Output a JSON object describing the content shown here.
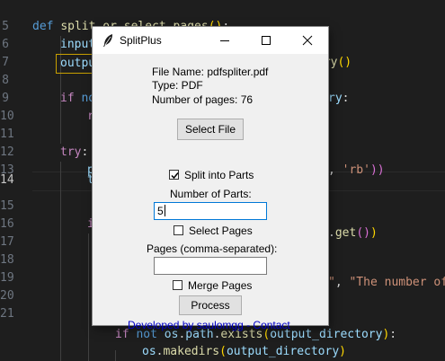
{
  "editor": {
    "line_numbers": [
      "5",
      "6",
      "7",
      "8",
      "9",
      "10",
      "11",
      "12",
      "13",
      "14",
      "15",
      "16",
      "17",
      "18",
      "19",
      "20",
      "21"
    ],
    "active_line": "14"
  },
  "window": {
    "title": "SplitPlus",
    "file_name_label": "File Name: pdfspliter.pdf",
    "type_label": "Type: PDF",
    "pages_label": "Number of pages: 76",
    "select_file_button": "Select File",
    "split_parts_label": "Split into Parts",
    "split_parts_checked": true,
    "number_of_parts_label": "Number of Parts:",
    "number_of_parts_value": "5",
    "select_pages_label": "Select Pages",
    "select_pages_checked": false,
    "pages_input_label": "Pages (comma-separated):",
    "pages_input_value": "",
    "merge_pages_label": "Merge Pages",
    "merge_pages_checked": false,
    "process_button": "Process",
    "footer_link": "Developed by saulomgg - Contact"
  }
}
